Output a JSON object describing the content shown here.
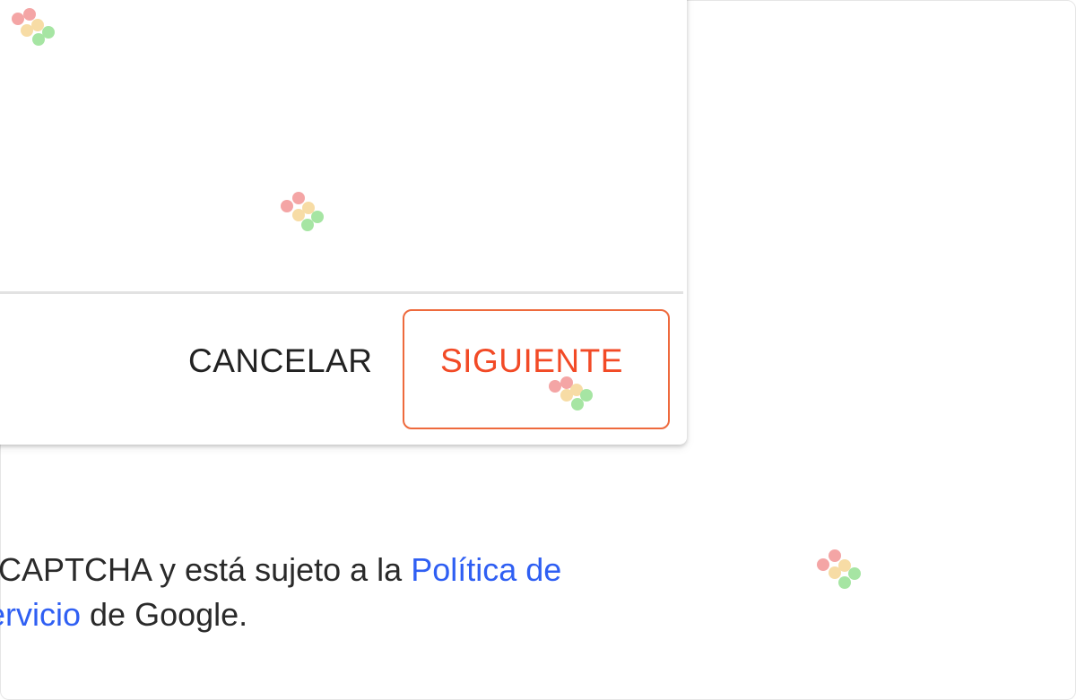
{
  "dialog": {
    "cancel_label": "CANCELAR",
    "next_label": "SIGUIENTE"
  },
  "footer": {
    "line1_prefix": "CAPTCHA y está sujeto a la ",
    "line1_link": "Política de",
    "line2_link": "ervicio",
    "line2_suffix": " de Google."
  },
  "colors": {
    "accent": "#f24a26",
    "highlight_border": "#ee6a3d",
    "link": "#2f5ff3"
  },
  "icons": [
    "watermark-dots-icon"
  ]
}
